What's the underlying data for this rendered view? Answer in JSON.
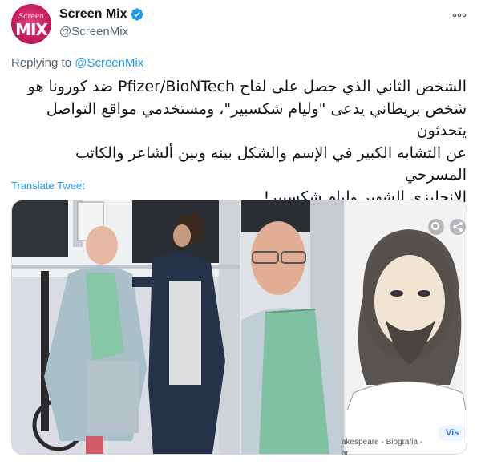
{
  "account": {
    "avatar_small": "Screen",
    "avatar_big": "MIX",
    "display_name": "Screen Mix",
    "handle": "@ScreenMix"
  },
  "reply": {
    "prefix": "Replying to ",
    "mention": "@ScreenMix"
  },
  "tweet": {
    "text": "الشخص الثاني الذي حصل على لقاح Pfizer/BioNTech ضد كورونا هو\nشخص بريطاني يدعى \"وليام شكسبير\"، ومستخدمي مواقع التواصل يتحدثون\nعن التشابه الكبير في الإسم والشكل بينه وبين ألشاعر والكاتب المسرحي\nالإنجليزي الشهير وليام شكسبير!",
    "translate_label": "Translate Tweet"
  },
  "media": {
    "caption_line1": "akespeare - Biografia -",
    "caption_line2": "ar",
    "visit_label": "Vis"
  },
  "colors": {
    "link": "#1d9bf0",
    "verified": "#1d9bf0",
    "brand": "#c41c5f"
  },
  "icons": [
    "verified-badge-icon",
    "more-options-icon",
    "share-icon",
    "lens-icon"
  ]
}
